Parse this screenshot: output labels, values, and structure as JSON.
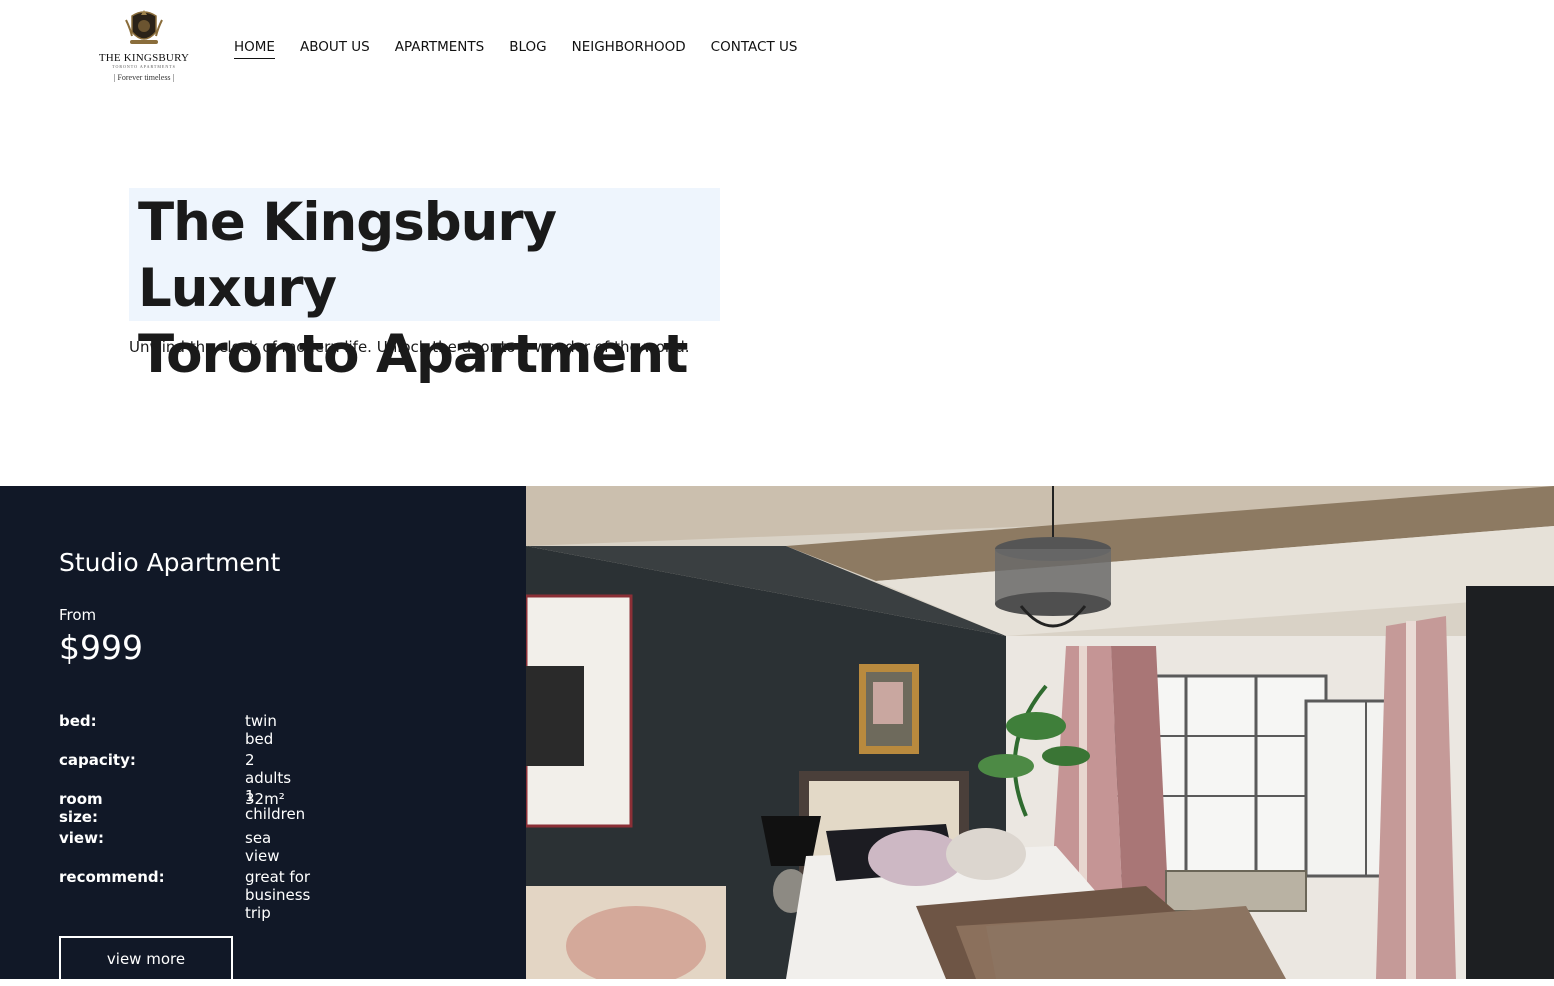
{
  "header": {
    "logo": {
      "name": "THE KINGSBURY",
      "subline": "TORONTO APARTMENTS",
      "tagline": "| Forever timeless |"
    },
    "nav": [
      {
        "label": "HOME",
        "active": true
      },
      {
        "label": "ABOUT US",
        "active": false
      },
      {
        "label": "APARTMENTS",
        "active": false
      },
      {
        "label": "BLOG",
        "active": false
      },
      {
        "label": "NEIGHBORHOOD",
        "active": false
      },
      {
        "label": "CONTACT US",
        "active": false
      }
    ]
  },
  "hero": {
    "title_line1": "The Kingsbury Luxury",
    "title_line2": "Toronto Apartment",
    "subtitle": "Unwind the clock of modern life. Unlock the door to a wonder of the world."
  },
  "apartment": {
    "name": "Studio Apartment",
    "from_label": "From",
    "price": "$999",
    "specs": [
      {
        "key": "bed:",
        "value": "twin bed"
      },
      {
        "key": "capacity:",
        "value": "2 adults 1 children"
      },
      {
        "key": "room size:",
        "value": "32m²"
      },
      {
        "key": "view:",
        "value": "sea view"
      },
      {
        "key": "recommend:",
        "value": "great for business trip"
      }
    ],
    "cta_label": "view more"
  },
  "colors": {
    "panel_bg": "#111827",
    "hero_highlight": "#eef5fd",
    "text": "#111111"
  }
}
